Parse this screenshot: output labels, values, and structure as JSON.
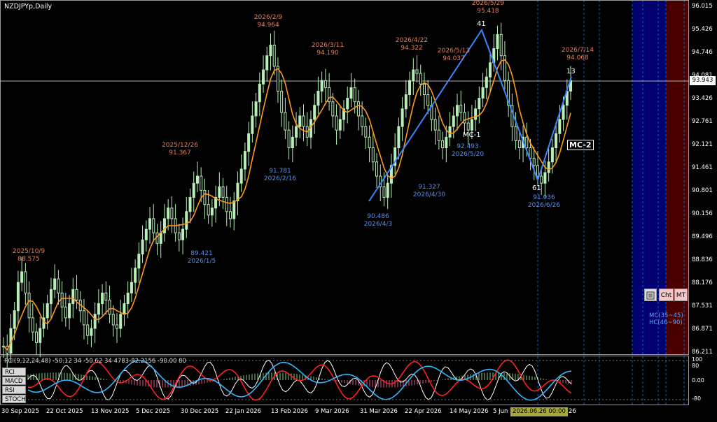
{
  "symbol_label": "NZDJPYp,Daily",
  "indicator_line": "RCI(9,12,24,48) -50.12 34 -50.62 34 4783-82.2156 -90.00 80",
  "price_axis": [
    "96.015",
    "95.426",
    "94.746",
    "94.081",
    "93.426",
    "92.761",
    "92.121",
    "91.461",
    "90.801",
    "90.156",
    "89.496",
    "88.836",
    "88.176",
    "87.531",
    "86.871",
    "86.211"
  ],
  "current_price": "93.943",
  "osc_axis": [
    "100",
    "80",
    "0.00",
    "-80"
  ],
  "date_axis": [
    "30 Sep 2025",
    "22 Oct 2025",
    "13 Nov 2025",
    "5 Dec 2025",
    "30 Dec 2025",
    "22 Jan 2026",
    "13 Feb 2026",
    "9 Mar 2026",
    "31 Mar 2026",
    "22 Apr 2026",
    "14 May 2026",
    "5 Jun 2026",
    "26"
  ],
  "crosshair_date": "2026.06.26 00:00",
  "side_buttons": [
    "RCI",
    "MACD",
    "RSI",
    "STOCH"
  ],
  "toolbar": {
    "icon": "list-icon",
    "cht": "Cht",
    "mt": "MT"
  },
  "mc_hc_labels": [
    "MC(35~45)",
    "HC(46~90)"
  ],
  "wave_labels": {
    "top": "41",
    "bottom": "61",
    "end": "13",
    "mc1": "MC-1",
    "mc2": "MC-2"
  },
  "highs": [
    {
      "date": "2025/10/9",
      "price": "88.575"
    },
    {
      "date": "2025/12/26",
      "price": "91.367"
    },
    {
      "date": "2026/2/9",
      "price": "94.964"
    },
    {
      "date": "2026/3/11",
      "price": "94.190"
    },
    {
      "date": "2026/4/22",
      "price": "94.322"
    },
    {
      "date": "2026/5/13",
      "price": "94.037"
    },
    {
      "date": "2026/5/29",
      "price": "95.418"
    },
    {
      "date": "2026/7/14",
      "price": "94.068"
    }
  ],
  "lows": [
    {
      "price": "89.421",
      "date": "2026/1/5"
    },
    {
      "price": "91.781",
      "date": "2026/2/16"
    },
    {
      "price": "90.486",
      "date": "2026/4/3"
    },
    {
      "price": "91.327",
      "date": "2026/4/30"
    },
    {
      "price": "92.493",
      "date": "2026/5/20"
    },
    {
      "price": "91.036",
      "date": "2026/6/26"
    }
  ],
  "colors": {
    "high": "#e67e5a",
    "low": "#5b8ee8",
    "candle": "#b6f0b6",
    "ma": "#ff9a1a",
    "zigzag": "#3a86ff",
    "blue_zone": "#00006e",
    "red_zone": "#4a0000"
  },
  "chart_data": {
    "type": "candlestick",
    "closes": [
      86.4,
      86.2,
      86.9,
      87.4,
      88.2,
      88.5,
      87.9,
      87.2,
      86.8,
      86.5,
      86.9,
      87.2,
      87.6,
      88.0,
      88.3,
      87.9,
      87.5,
      87.2,
      87.6,
      88.0,
      87.7,
      87.4,
      87.0,
      86.7,
      86.9,
      87.3,
      87.6,
      87.9,
      87.7,
      87.3,
      87.0,
      86.9,
      87.3,
      87.6,
      87.9,
      88.2,
      88.6,
      89.0,
      89.4,
      89.7,
      90.0,
      89.6,
      89.3,
      89.6,
      90.0,
      90.3,
      90.0,
      89.6,
      89.4,
      89.7,
      90.2,
      90.6,
      91.0,
      91.2,
      90.8,
      90.4,
      90.1,
      90.3,
      90.6,
      90.9,
      90.6,
      90.2,
      90.0,
      90.5,
      91.0,
      91.4,
      91.9,
      92.4,
      92.9,
      93.3,
      93.8,
      94.2,
      94.6,
      94.9,
      94.3,
      93.6,
      93.0,
      92.5,
      92.0,
      92.3,
      92.6,
      92.9,
      92.6,
      92.3,
      92.8,
      93.2,
      93.6,
      93.9,
      93.7,
      93.3,
      92.9,
      92.5,
      92.8,
      93.1,
      93.4,
      93.7,
      93.3,
      92.9,
      92.6,
      92.3,
      92.0,
      91.6,
      91.2,
      90.9,
      90.6,
      91.0,
      91.5,
      92.0,
      92.6,
      93.1,
      93.5,
      93.9,
      94.2,
      94.1,
      93.8,
      93.5,
      93.2,
      92.8,
      92.5,
      92.2,
      92.0,
      92.3,
      92.6,
      92.9,
      93.2,
      93.0,
      92.7,
      92.5,
      92.8,
      93.1,
      93.4,
      93.7,
      94.0,
      94.4,
      94.8,
      95.2,
      94.6,
      93.9,
      93.2,
      92.6,
      92.2,
      92.0,
      92.3,
      92.0,
      91.7,
      91.5,
      91.2,
      91.0,
      91.3,
      91.6,
      92.0,
      92.4,
      92.8,
      93.2,
      93.6,
      93.9
    ]
  }
}
